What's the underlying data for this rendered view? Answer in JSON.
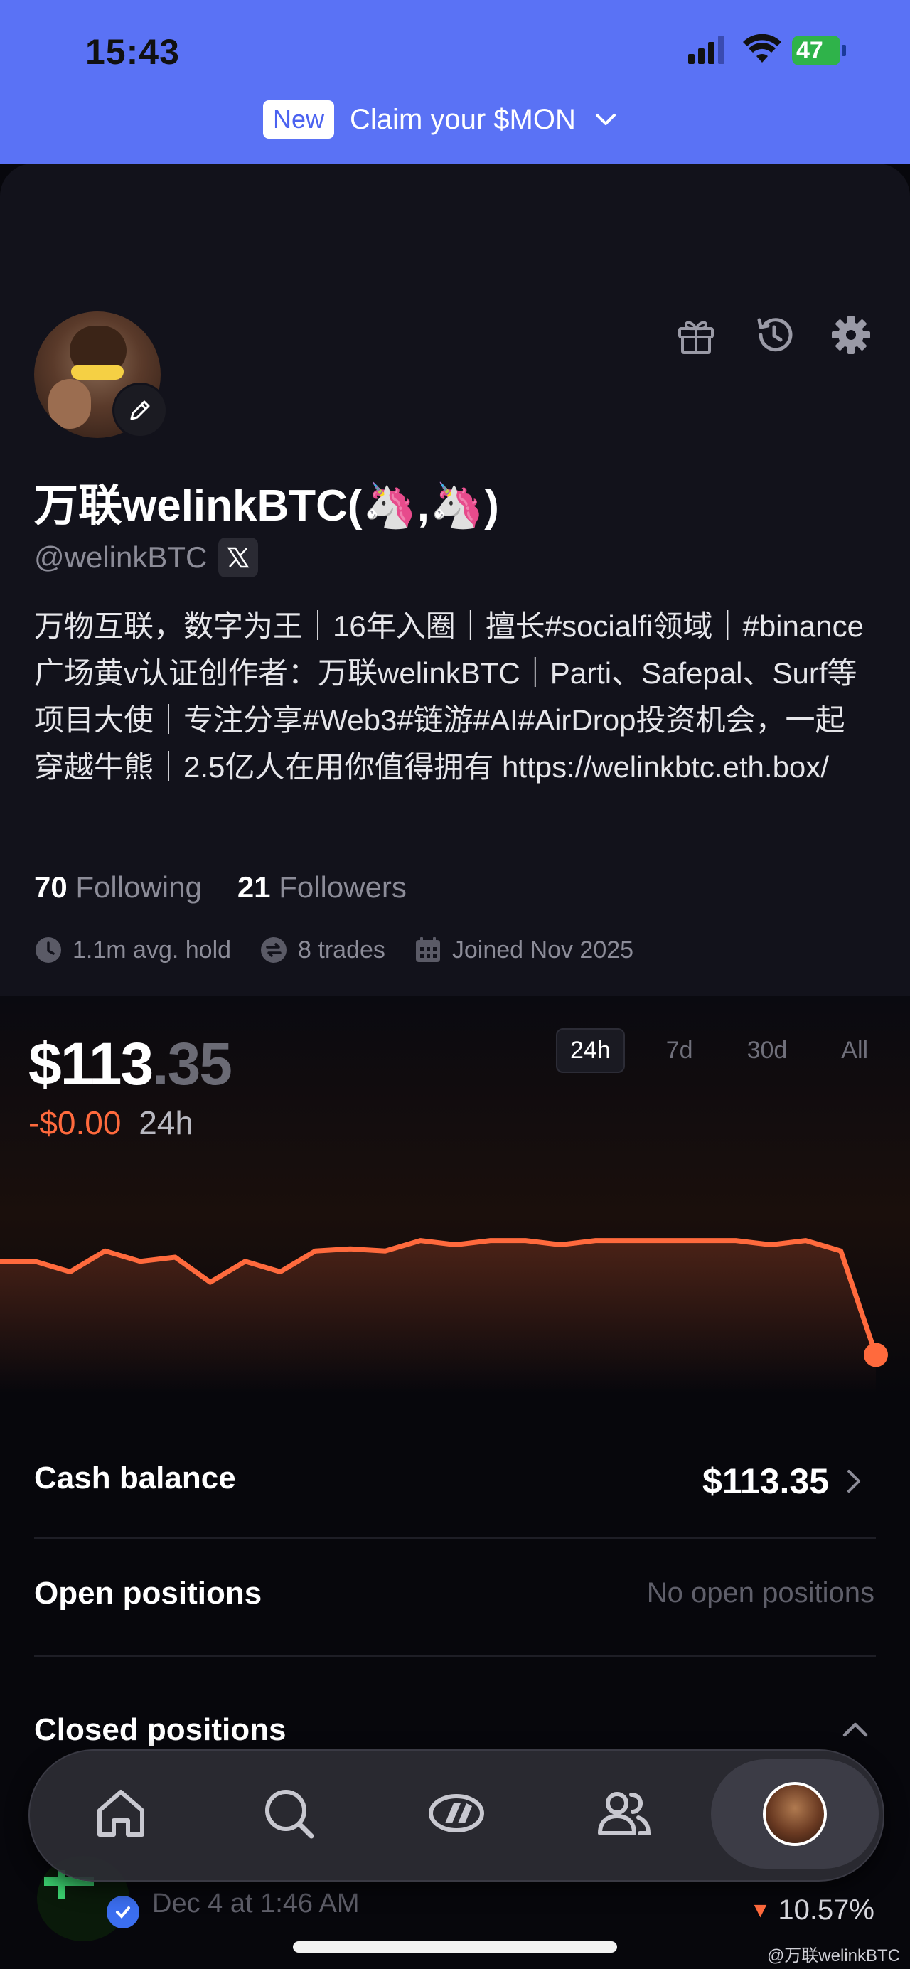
{
  "status_bar": {
    "time": "15:43",
    "battery": "47"
  },
  "promo": {
    "badge": "New",
    "text": "Claim your $MON"
  },
  "profile": {
    "display_name": "万联welinkBTC(🦄,🦄)",
    "handle": "@welinkBTC",
    "bio": "万物互联，数字为王｜16年入圈｜擅长#socialfi领域｜#binance 广场黄v认证创作者：万联welinkBTC｜Parti、Safepal、Surf等项目大使｜专注分享#Web3#链游#AI#AirDrop投资机会，一起穿越牛熊｜2.5亿人在用你值得拥有 https://welinkbtc.eth.box/",
    "following_count": "70",
    "following_label": "Following",
    "followers_count": "21",
    "followers_label": "Followers",
    "avg_hold": "1.1m avg. hold",
    "trades": "8 trades",
    "joined": "Joined Nov 2025"
  },
  "portfolio": {
    "value_whole": "$113",
    "value_cents": ".35",
    "change_amount": "-$0.00",
    "change_period": "24h",
    "ranges": [
      "24h",
      "7d",
      "30d",
      "All"
    ],
    "active_range": "24h",
    "line_color": "#ff6a3d"
  },
  "chart_data": {
    "type": "area",
    "x": [
      0,
      1,
      2,
      3,
      4,
      5,
      6,
      7,
      8,
      9,
      10,
      11,
      12,
      13,
      14,
      15,
      16,
      17,
      18,
      19,
      20,
      21,
      22,
      23,
      24,
      25
    ],
    "values": [
      113.8,
      113.8,
      113.75,
      113.85,
      113.8,
      113.82,
      113.7,
      113.8,
      113.75,
      113.85,
      113.86,
      113.85,
      113.9,
      113.88,
      113.9,
      113.9,
      113.88,
      113.9,
      113.9,
      113.9,
      113.9,
      113.9,
      113.88,
      113.9,
      113.85,
      113.35
    ],
    "ylim": [
      113.3,
      113.95
    ],
    "xlabel": "",
    "ylabel": "",
    "grid": false
  },
  "rows": {
    "cash_label": "Cash balance",
    "cash_value": "$113.35",
    "open_label": "Open positions",
    "open_empty": "No open positions",
    "closed_label": "Closed positions"
  },
  "closed_position": {
    "date": "Dec 4 at 1:46 AM",
    "change": "10.57%"
  },
  "watermark": "@万联welinkBTC"
}
